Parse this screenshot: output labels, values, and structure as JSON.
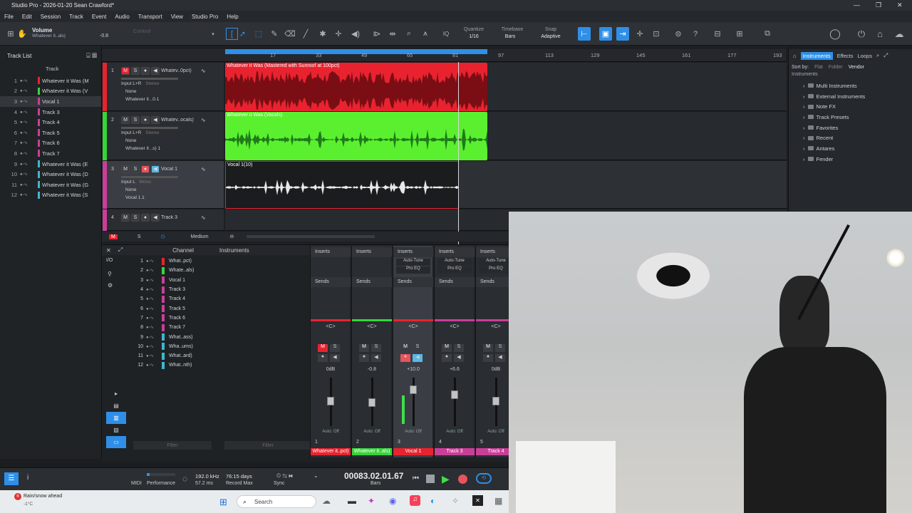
{
  "window": {
    "title": "Studio Pro - 2026-01-20 Sean Crawford*",
    "controls": [
      "—",
      "❐",
      "✕"
    ]
  },
  "menu": [
    "File",
    "Edit",
    "Session",
    "Track",
    "Event",
    "Audio",
    "Transport",
    "View",
    "Studio Pro",
    "Help"
  ],
  "toolbar": {
    "param_name": "Volume",
    "param_track": "Whatever it..als)",
    "param_value": "-0.8",
    "control_label": "Control",
    "quantize_label": "Quantize",
    "quantize_value": "1/16",
    "timebase_label": "Timebase",
    "timebase_value": "Bars",
    "snap_label": "Snap",
    "snap_value": "Adaptive",
    "iq_label": "IQ"
  },
  "tracklist": {
    "title": "Track List",
    "column": "Track",
    "tracks": [
      {
        "n": "1",
        "name": "Whatever it Was (M",
        "color": "#e8232f"
      },
      {
        "n": "2",
        "name": "Whatever it Was (V",
        "color": "#37d43a"
      },
      {
        "n": "3",
        "name": "Vocal 1",
        "color": "#c93f98"
      },
      {
        "n": "4",
        "name": "Track 3",
        "color": "#c93f98"
      },
      {
        "n": "5",
        "name": "Track 4",
        "color": "#c93f98"
      },
      {
        "n": "6",
        "name": "Track 5",
        "color": "#c93f98"
      },
      {
        "n": "7",
        "name": "Track 6",
        "color": "#c93f98"
      },
      {
        "n": "8",
        "name": "Track 7",
        "color": "#c93f98"
      },
      {
        "n": "9",
        "name": "Whatever it Was (E",
        "color": "#3fb6cf"
      },
      {
        "n": "10",
        "name": "Whatever it Was (D",
        "color": "#3fb6cf"
      },
      {
        "n": "11",
        "name": "Whatever it Was (G",
        "color": "#3fb6cf"
      },
      {
        "n": "12",
        "name": "Whatever it Was (S",
        "color": "#3fb6cf"
      }
    ]
  },
  "ruler": [
    "17",
    "33",
    "49",
    "65",
    "81",
    "97",
    "113",
    "129",
    "145",
    "161",
    "177",
    "193"
  ],
  "arrange_tracks": [
    {
      "n": "1",
      "name": "Whatev..0pct)",
      "input": "Input L+R",
      "mode": "Stereo",
      "out": "None",
      "sub": "Whatever it ..0.1",
      "color": "#e8232f"
    },
    {
      "n": "2",
      "name": "Whatev..ocals)",
      "input": "Input L+R",
      "mode": "Stereo",
      "out": "None",
      "sub": "Whatever it ..s) 1",
      "color": "#37d43a"
    },
    {
      "n": "3",
      "name": "Vocal 1",
      "input": "Input L",
      "mode": "Mono",
      "out": "None",
      "sub": "Vocal 1.1",
      "color": "#c93f98"
    },
    {
      "n": "4",
      "name": "Track 3",
      "color": "#c93f98"
    }
  ],
  "clips": {
    "c1": "Whatever it Was (Mastered with Sunroof at 100pct)",
    "c2": "Whatever it Was (Vocals)",
    "c3": "Vocal 1(10)"
  },
  "arrange_footer": {
    "size": "Medium"
  },
  "browser": {
    "tabs": [
      "Instruments",
      "Effects",
      "Loops"
    ],
    "sort_label": "Sort by:",
    "sort_options": [
      "Flat",
      "Folder",
      "Vendor"
    ],
    "path": "Instruments",
    "items": [
      "Multi Instruments",
      "External Instruments",
      "Note FX",
      "Track Presets",
      "Favorites",
      "Recent",
      "Antares",
      "Fender"
    ]
  },
  "console": {
    "left_icons": [
      "I/O"
    ],
    "channel_header": "Channel",
    "instruments_header": "Instruments",
    "channels": [
      {
        "n": "1",
        "name": "What..pct)",
        "color": "#e8232f"
      },
      {
        "n": "2",
        "name": "Whate..als)",
        "color": "#37d43a"
      },
      {
        "n": "3",
        "name": "Vocal 1",
        "color": "#c93f98"
      },
      {
        "n": "4",
        "name": "Track 3",
        "color": "#c93f98"
      },
      {
        "n": "5",
        "name": "Track 4",
        "color": "#c93f98"
      },
      {
        "n": "6",
        "name": "Track 5",
        "color": "#c93f98"
      },
      {
        "n": "7",
        "name": "Track 6",
        "color": "#c93f98"
      },
      {
        "n": "8",
        "name": "Track 7",
        "color": "#c93f98"
      },
      {
        "n": "9",
        "name": "What..ass)",
        "color": "#3fb6cf"
      },
      {
        "n": "10",
        "name": "Wha..ums)",
        "color": "#3fb6cf"
      },
      {
        "n": "11",
        "name": "What..ard)",
        "color": "#3fb6cf"
      },
      {
        "n": "12",
        "name": "What..nth)",
        "color": "#3fb6cf"
      }
    ],
    "filter_placeholder": "Filter",
    "strips": [
      {
        "n": "1",
        "ins": "Inserts",
        "plugins": [],
        "sends": "Sends",
        "db": "0dB",
        "auto": "Auto: Off",
        "name": "Whatever it..pct)",
        "color": "#e8232f",
        "level": 0.62
      },
      {
        "n": "2",
        "ins": "Inserts",
        "plugins": [],
        "sends": "Sends",
        "db": "-0.8",
        "auto": "Auto: Off",
        "name": "Whatever it..als)",
        "color": "#37d43a",
        "level": 0.6
      },
      {
        "n": "3",
        "ins": "Inserts",
        "plugins": [
          "Auto-Tune",
          "Pro EQ"
        ],
        "sends": "Sends",
        "db": "+10.0",
        "auto": "Auto: Off",
        "name": "Vocal 1",
        "color": "#e8232f",
        "level": 0.82
      },
      {
        "n": "4",
        "ins": "Inserts",
        "plugins": [
          "Auto-Tune",
          "Pro EQ"
        ],
        "sends": "Sends",
        "db": "+6.6",
        "auto": "Auto: Off",
        "name": "Track 3",
        "color": "#c93f98",
        "level": 0.74
      },
      {
        "n": "5",
        "ins": "Inserts",
        "plugins": [
          "Auto-Tune",
          "Pro EQ"
        ],
        "sends": "Sends",
        "db": "0dB",
        "auto": "Auto: Off",
        "name": "Track 4",
        "color": "#c93f98",
        "level": 0.62
      }
    ]
  },
  "transport": {
    "midi": "MIDI",
    "performance": "Performance",
    "rate": "192.0 kHz",
    "latency": "57.2 ms",
    "days": "76:15 days",
    "record_max": "Record Max",
    "sync": "Sync",
    "position": "00083.02.01.67",
    "timebase": "Bars"
  },
  "taskbar": {
    "weather": "Rain/snow ahead",
    "temp": "-1°C",
    "badge": "6",
    "search_placeholder": "Search"
  },
  "colors": {
    "accent": "#2f8fe8",
    "red": "#e8232f",
    "green": "#37d43a",
    "magenta": "#c93f98",
    "cyan": "#3fb6cf"
  }
}
